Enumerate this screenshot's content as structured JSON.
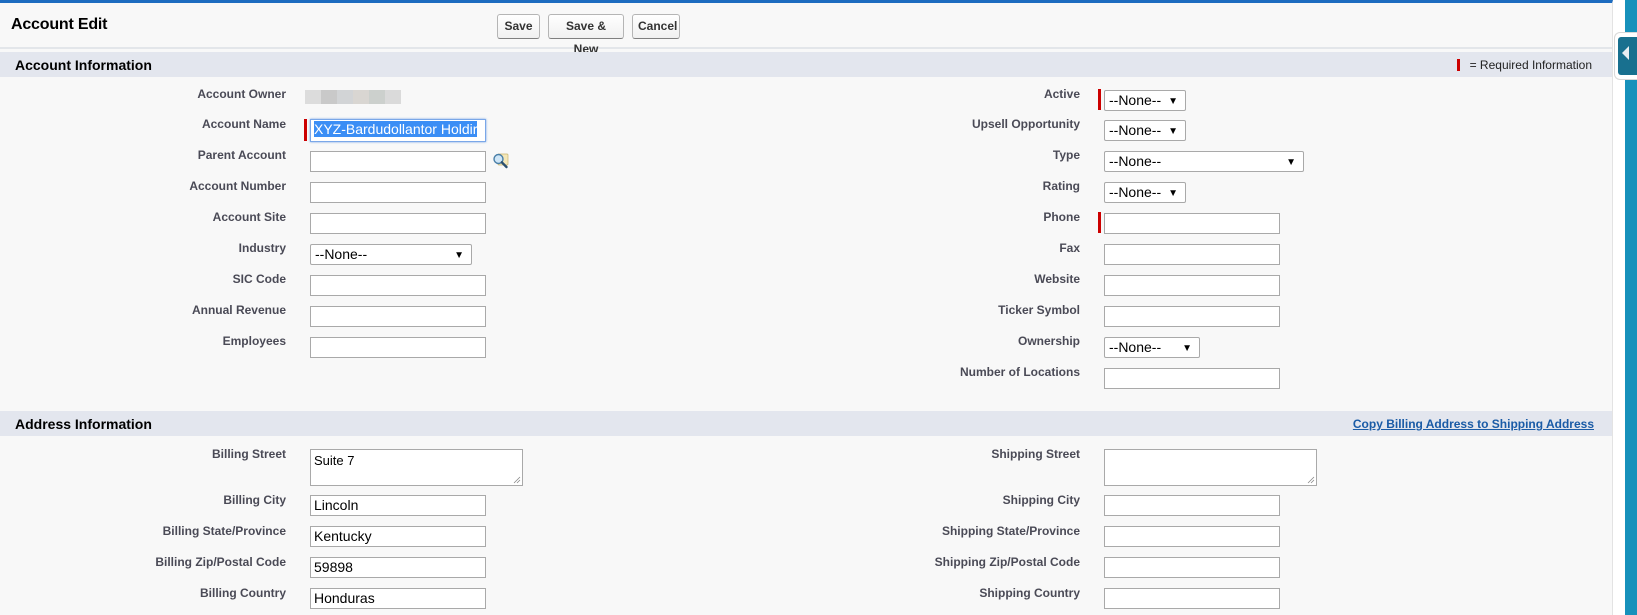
{
  "header": {
    "title": "Account Edit",
    "buttons": {
      "save": "Save",
      "save_new": "Save & New",
      "cancel": "Cancel"
    }
  },
  "account_section": {
    "title": "Account Information",
    "required_legend": "= Required Information",
    "left_fields": {
      "owner": {
        "label": "Account Owner",
        "value": ""
      },
      "name": {
        "label": "Account Name",
        "value": "XYZ-Bardudollantor Holdir",
        "required": true
      },
      "parent": {
        "label": "Parent Account",
        "value": ""
      },
      "number": {
        "label": "Account Number",
        "value": ""
      },
      "site": {
        "label": "Account Site",
        "value": ""
      },
      "industry": {
        "label": "Industry",
        "value": "--None--"
      },
      "sic": {
        "label": "SIC Code",
        "value": ""
      },
      "revenue": {
        "label": "Annual Revenue",
        "value": ""
      },
      "employees": {
        "label": "Employees",
        "value": ""
      }
    },
    "right_fields": {
      "active": {
        "label": "Active",
        "value": "--None--",
        "required": true
      },
      "upsell": {
        "label": "Upsell Opportunity",
        "value": "--None--"
      },
      "type": {
        "label": "Type",
        "value": "--None--"
      },
      "rating": {
        "label": "Rating",
        "value": "--None--"
      },
      "phone": {
        "label": "Phone",
        "value": "",
        "required": true
      },
      "fax": {
        "label": "Fax",
        "value": ""
      },
      "website": {
        "label": "Website",
        "value": ""
      },
      "ticker": {
        "label": "Ticker Symbol",
        "value": ""
      },
      "ownership": {
        "label": "Ownership",
        "value": "--None--"
      },
      "locations": {
        "label": "Number of Locations",
        "value": ""
      }
    }
  },
  "address_section": {
    "title": "Address Information",
    "copy_link": "Copy Billing Address to Shipping Address",
    "billing": {
      "street": {
        "label": "Billing Street",
        "value": "Suite 7"
      },
      "city": {
        "label": "Billing City",
        "value": "Lincoln"
      },
      "state": {
        "label": "Billing State/Province",
        "value": "Kentucky"
      },
      "zip": {
        "label": "Billing Zip/Postal Code",
        "value": "59898"
      },
      "country": {
        "label": "Billing Country",
        "value": "Honduras"
      }
    },
    "shipping": {
      "street": {
        "label": "Shipping Street",
        "value": ""
      },
      "city": {
        "label": "Shipping City",
        "value": ""
      },
      "state": {
        "label": "Shipping State/Province",
        "value": ""
      },
      "zip": {
        "label": "Shipping Zip/Postal Code",
        "value": ""
      },
      "country": {
        "label": "Shipping Country",
        "value": ""
      }
    }
  },
  "colors": {
    "accent": "#1d6cc0",
    "required": "#cc0000",
    "section_bg": "#e3e6ee",
    "link": "#1a5ba6",
    "sidebar": "#1791bb"
  }
}
